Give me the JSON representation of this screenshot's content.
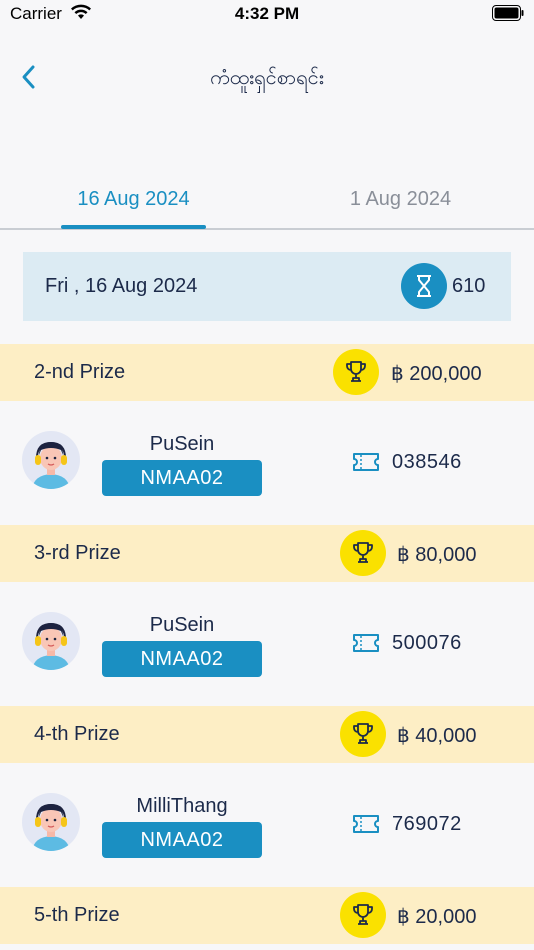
{
  "status_bar": {
    "carrier": "Carrier",
    "time": "4:32 PM"
  },
  "nav": {
    "title": "ကံထူးရှင်စာရင်း"
  },
  "tabs": [
    {
      "label": "16 Aug 2024",
      "active": true
    },
    {
      "label": "1 Aug 2024",
      "active": false
    }
  ],
  "draw": {
    "date": "Fri , 16 Aug 2024",
    "count": "610"
  },
  "prizes": [
    {
      "label": "2-nd Prize",
      "amount": "฿ 200,000",
      "winner": {
        "name": "PuSein",
        "code": "NMAA02",
        "ticket": "038546"
      }
    },
    {
      "label": "3-rd Prize",
      "amount": "฿ 80,000",
      "winner": {
        "name": "PuSein",
        "code": "NMAA02",
        "ticket": "500076"
      }
    },
    {
      "label": "4-th Prize",
      "amount": "฿ 40,000",
      "winner": {
        "name": "MilliThang",
        "code": "NMAA02",
        "ticket": "769072"
      }
    },
    {
      "label": "5-th Prize",
      "amount": "฿ 20,000"
    }
  ],
  "colors": {
    "accent": "#1a8fc2",
    "prize_band": "#fdeec5",
    "trophy_bg": "#fae100",
    "date_card": "#dcebf3",
    "text": "#1c2a4a"
  }
}
